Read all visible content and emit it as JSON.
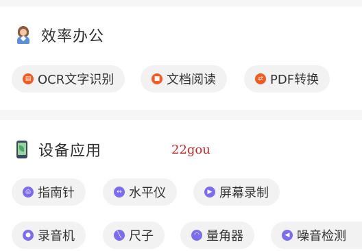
{
  "sections": [
    {
      "title": "效率办公",
      "icon": "office-worker-icon",
      "items": [
        {
          "label": "OCR文字识别",
          "icon": "ocr-icon"
        },
        {
          "label": "文档阅读",
          "icon": "document-icon"
        },
        {
          "label": "PDF转换",
          "icon": "pdf-convert-icon"
        }
      ]
    },
    {
      "title": "设备应用",
      "icon": "phone-icon",
      "items": [
        {
          "label": "指南针",
          "icon": "compass-icon"
        },
        {
          "label": "水平仪",
          "icon": "level-icon"
        },
        {
          "label": "屏幕录制",
          "icon": "screen-record-icon"
        },
        {
          "label": "录音机",
          "icon": "microphone-icon"
        },
        {
          "label": "尺子",
          "icon": "ruler-icon"
        },
        {
          "label": "量角器",
          "icon": "protractor-icon"
        },
        {
          "label": "噪音检测",
          "icon": "noise-detect-icon"
        }
      ]
    }
  ],
  "watermark": "22gou",
  "colors": {
    "office_icon": "#f25b21",
    "device_icon": "#7d6bf0",
    "chip_bg": "#f2f2f2"
  }
}
